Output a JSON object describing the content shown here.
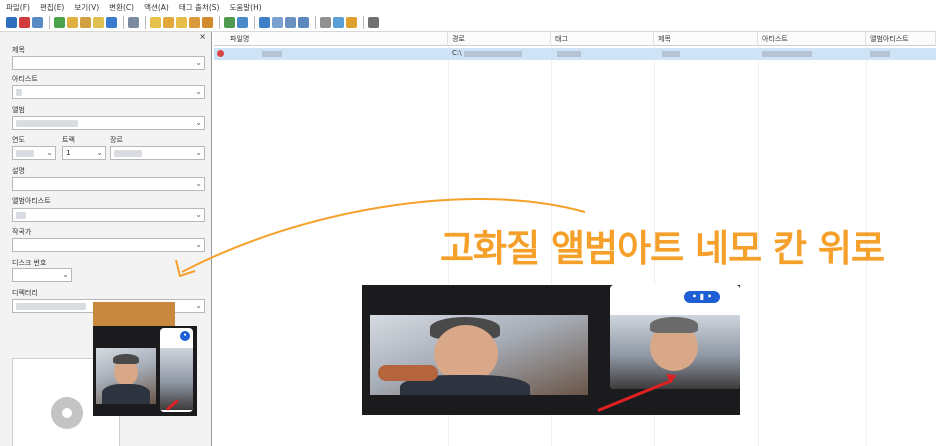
{
  "menu": [
    "파일(F)",
    "편집(E)",
    "보기(V)",
    "변환(C)",
    "액션(A)",
    "태그 출처(S)",
    "도움말(H)"
  ],
  "panel": {
    "close": "×",
    "labels": {
      "title": "제목",
      "artist": "아티스트",
      "album": "앨범",
      "year": "연도",
      "track": "트랙",
      "genre": "장르",
      "comment": "설명",
      "album_artist": "앨범아티스트",
      "composer": "작곡가",
      "disc": "디스크 번호",
      "directory": "디렉터리"
    },
    "track_value": "1"
  },
  "columns": [
    "파일명",
    "경로",
    "태그",
    "제목",
    "아티스트",
    "앨범아티스트"
  ],
  "row": {
    "path_prefix": "C:\\"
  },
  "annotation": "고화질 앨범아트 네모 칸 위로",
  "colors": {
    "annotation": "#f5a02a",
    "selection": "#cfe3f7",
    "arrow": "#e02020",
    "badge": "#1f5fd6"
  }
}
